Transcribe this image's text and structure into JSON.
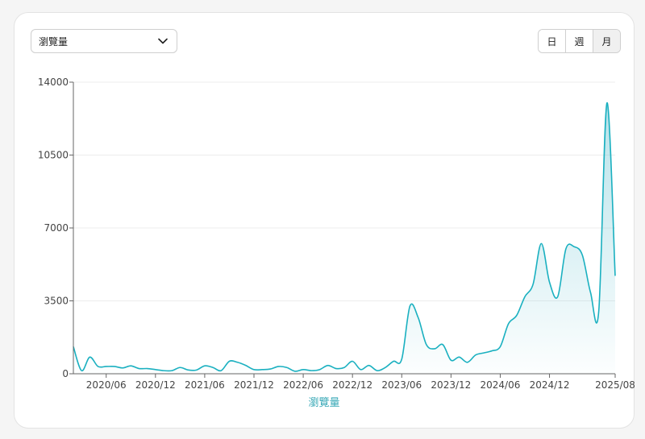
{
  "controls": {
    "metric_select": "瀏覽量",
    "ranges": [
      "日",
      "週",
      "月"
    ],
    "active_range": "月"
  },
  "colors": {
    "line": "#1ab0c0",
    "area_top": "#7ccbd8",
    "xlabel": "#3aa9b7"
  },
  "chart_data": {
    "type": "area",
    "title": "",
    "xlabel": "瀏覽量",
    "ylabel": "",
    "ylim": [
      0,
      14000
    ],
    "yticks": [
      0,
      3500,
      7000,
      10500,
      14000
    ],
    "xtick_labels": [
      "2020/06",
      "2020/12",
      "2021/06",
      "2021/12",
      "2022/06",
      "2022/12",
      "2023/06",
      "2023/12",
      "2024/06",
      "2024/12",
      "2025/08"
    ],
    "grid": true,
    "series": [
      {
        "name": "",
        "x": [
          "2020/02",
          "2020/03",
          "2020/04",
          "2020/05",
          "2020/06",
          "2020/07",
          "2020/08",
          "2020/09",
          "2020/10",
          "2020/11",
          "2020/12",
          "2021/01",
          "2021/02",
          "2021/03",
          "2021/04",
          "2021/05",
          "2021/06",
          "2021/07",
          "2021/08",
          "2021/09",
          "2021/10",
          "2021/11",
          "2021/12",
          "2022/01",
          "2022/02",
          "2022/03",
          "2022/04",
          "2022/05",
          "2022/06",
          "2022/07",
          "2022/08",
          "2022/09",
          "2022/10",
          "2022/11",
          "2022/12",
          "2023/01",
          "2023/02",
          "2023/03",
          "2023/04",
          "2023/05",
          "2023/06",
          "2023/07",
          "2023/08",
          "2023/09",
          "2023/10",
          "2023/11",
          "2023/12",
          "2024/01",
          "2024/02",
          "2024/03",
          "2024/04",
          "2024/05",
          "2024/06",
          "2024/07",
          "2024/08",
          "2024/09",
          "2024/10",
          "2024/11",
          "2024/12",
          "2025/01",
          "2025/02",
          "2025/03",
          "2025/04",
          "2025/05",
          "2025/06",
          "2025/07",
          "2025/08"
        ],
        "values": [
          1300,
          150,
          800,
          350,
          350,
          350,
          280,
          380,
          250,
          250,
          200,
          150,
          150,
          300,
          180,
          180,
          380,
          300,
          150,
          600,
          550,
          400,
          200,
          200,
          230,
          350,
          300,
          120,
          200,
          150,
          200,
          400,
          250,
          300,
          600,
          200,
          400,
          150,
          300,
          600,
          700,
          3250,
          2700,
          1400,
          1200,
          1400,
          650,
          800,
          550,
          900,
          1000,
          1100,
          1300,
          2400,
          2800,
          3700,
          4300,
          6250,
          4400,
          3700,
          6000,
          6100,
          5700,
          3900,
          3000,
          13000,
          4700
        ]
      }
    ]
  }
}
